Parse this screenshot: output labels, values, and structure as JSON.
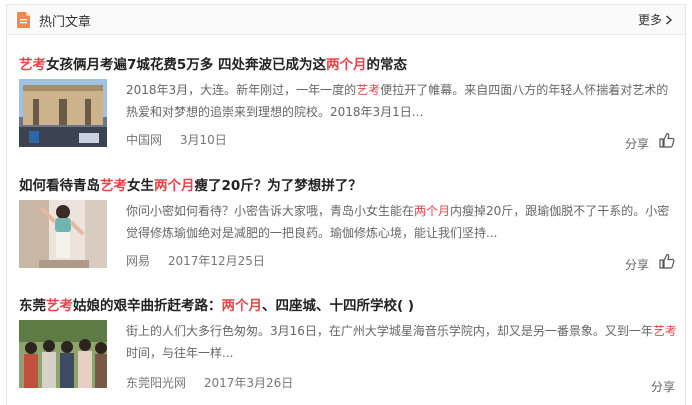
{
  "header": {
    "title": "热门文章",
    "more_label": "更多",
    "doc_icon": "document-icon",
    "accent_color": "#f08a4b"
  },
  "highlight_color": "#e0464b",
  "articles": [
    {
      "headline_parts": [
        {
          "text": "艺考",
          "highlight": true
        },
        {
          "text": "女孩俩月考遍7城花费5万多 四处奔波已成为这",
          "highlight": false
        },
        {
          "text": "两个月",
          "highlight": true
        },
        {
          "text": "的常态",
          "highlight": false
        }
      ],
      "summary_parts": [
        {
          "text": "2018年3月，大连。新年刚过，一年一度的",
          "highlight": false
        },
        {
          "text": "艺考",
          "highlight": true
        },
        {
          "text": "便拉开了帷幕。来自四面八方的年轻人怀揣着对艺术的热爱和对梦想的追崇来到理想的院校。2018年3月1日...",
          "highlight": false
        }
      ],
      "source": "中国网",
      "date": "3月10日",
      "share_label": "分享",
      "thumb": "school-gate"
    },
    {
      "headline_parts": [
        {
          "text": "如何看待青岛",
          "highlight": false
        },
        {
          "text": "艺考",
          "highlight": true
        },
        {
          "text": "女生",
          "highlight": false
        },
        {
          "text": "两个月",
          "highlight": true
        },
        {
          "text": "瘦了20斤？为了梦想拼了？",
          "highlight": false
        }
      ],
      "summary_parts": [
        {
          "text": "你问小密如何看待？小密告诉大家哦，青岛小女生能在",
          "highlight": false
        },
        {
          "text": "两个月",
          "highlight": true
        },
        {
          "text": "内瘦掉20斤，跟瑜伽脱不了干系的。小密觉得修炼瑜伽绝对是减肥的一把良药。瑜伽修炼心境，能让我们坚持...",
          "highlight": false
        }
      ],
      "source": "网易",
      "date": "2017年12月25日",
      "share_label": "分享",
      "thumb": "yoga-girl"
    },
    {
      "headline_parts": [
        {
          "text": "东莞",
          "highlight": false
        },
        {
          "text": "艺考",
          "highlight": true
        },
        {
          "text": "姑娘的艰辛曲折赶考路：",
          "highlight": false
        },
        {
          "text": "两个月",
          "highlight": true
        },
        {
          "text": "、四座城、十四所学校( )",
          "highlight": false
        }
      ],
      "summary_parts": [
        {
          "text": "街上的人们大多行色匆匆。3月16日，在广州大学城星海音乐学院内，却又是另一番景象。又到一年",
          "highlight": false
        },
        {
          "text": "艺考",
          "highlight": true
        },
        {
          "text": "时间，与往年一样...",
          "highlight": false
        }
      ],
      "source": "东莞阳光网",
      "date": "2017年3月26日",
      "share_label": "分享",
      "thumb": "crowd"
    }
  ]
}
